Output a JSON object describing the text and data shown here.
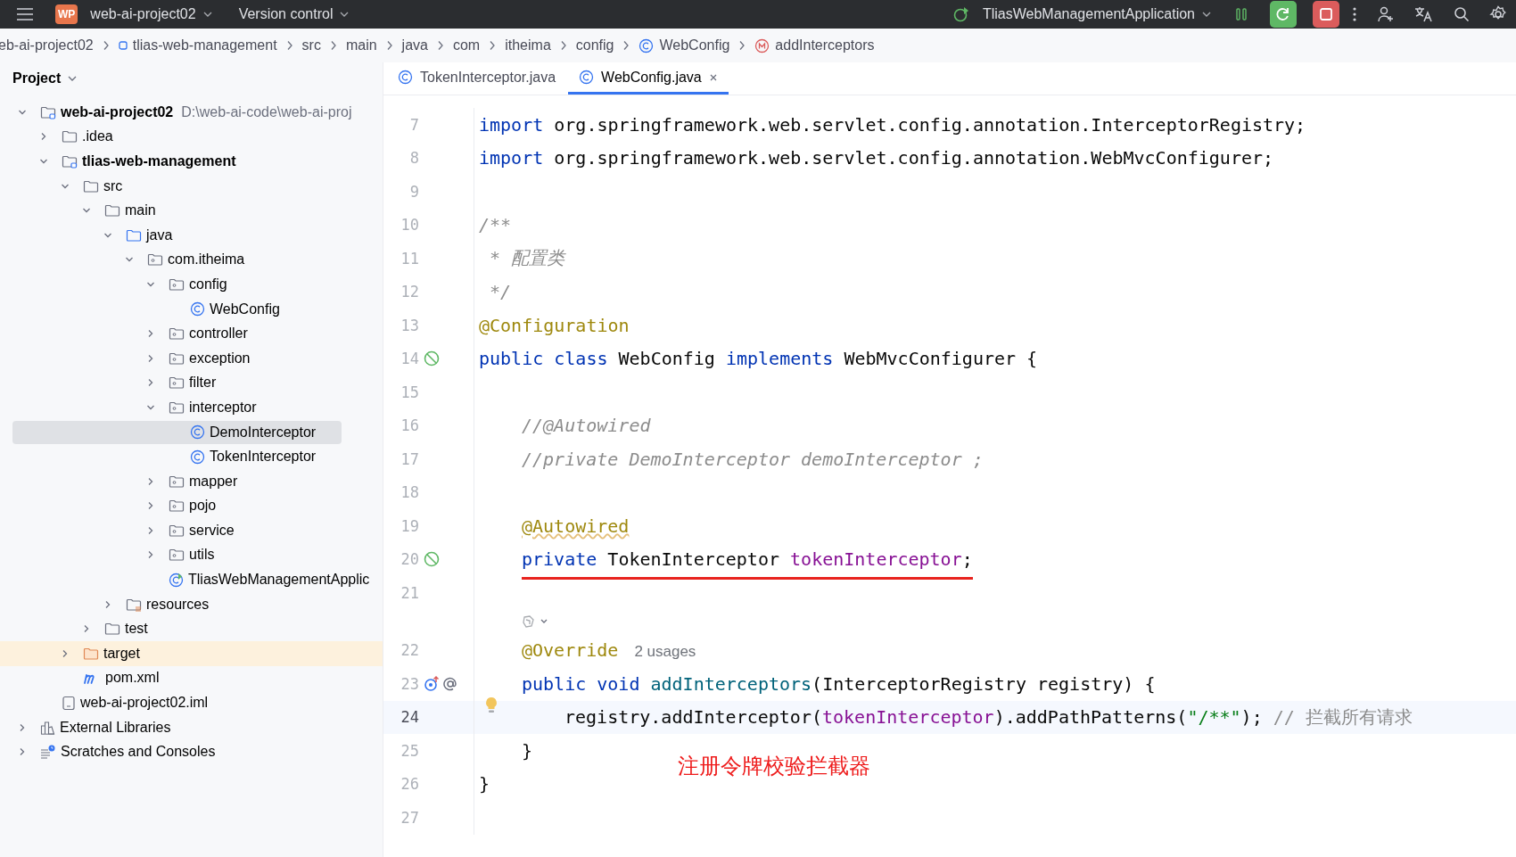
{
  "title_bar": {
    "project_badge": "WP",
    "project": "web-ai-project02",
    "vcs": "Version control",
    "run_config": "TliasWebManagementApplication"
  },
  "breadcrumbs": [
    {
      "label": "eb-ai-project02",
      "kind": "folder"
    },
    {
      "label": "tlias-web-management",
      "kind": "module"
    },
    {
      "label": "src",
      "kind": "folder"
    },
    {
      "label": "main",
      "kind": "folder"
    },
    {
      "label": "java",
      "kind": "folder"
    },
    {
      "label": "com",
      "kind": "folder"
    },
    {
      "label": "itheima",
      "kind": "folder"
    },
    {
      "label": "config",
      "kind": "folder"
    },
    {
      "label": "WebConfig",
      "kind": "class"
    },
    {
      "label": "addInterceptors",
      "kind": "method"
    }
  ],
  "project_panel": {
    "title": "Project"
  },
  "tree": [
    {
      "label": "web-ai-project02",
      "path": "D:\\web-ai-code\\web-ai-proj",
      "kind": "module",
      "expanded": true,
      "selected": false,
      "children": [
        {
          "label": ".idea",
          "kind": "folder",
          "expanded": false,
          "selected": false
        },
        {
          "label": "tlias-web-management",
          "kind": "module",
          "expanded": true,
          "selected": false,
          "children": [
            {
              "label": "src",
              "kind": "folder",
              "expanded": true,
              "selected": false,
              "children": [
                {
                  "label": "main",
                  "kind": "folder",
                  "expanded": true,
                  "selected": false,
                  "children": [
                    {
                      "label": "java",
                      "kind": "source-folder",
                      "expanded": true,
                      "selected": false,
                      "children": [
                        {
                          "label": "com.itheima",
                          "kind": "package",
                          "expanded": true,
                          "selected": false,
                          "children": [
                            {
                              "label": "config",
                              "kind": "package",
                              "expanded": true,
                              "selected": false,
                              "children": [
                                {
                                  "label": "WebConfig",
                                  "kind": "class",
                                  "selected": false
                                }
                              ]
                            },
                            {
                              "label": "controller",
                              "kind": "package",
                              "expanded": false,
                              "selected": false
                            },
                            {
                              "label": "exception",
                              "kind": "package",
                              "expanded": false,
                              "selected": false
                            },
                            {
                              "label": "filter",
                              "kind": "package",
                              "expanded": false,
                              "selected": false
                            },
                            {
                              "label": "interceptor",
                              "kind": "package",
                              "expanded": true,
                              "selected": false,
                              "children": [
                                {
                                  "label": "DemoInterceptor",
                                  "kind": "class",
                                  "selected": true
                                },
                                {
                                  "label": "TokenInterceptor",
                                  "kind": "class",
                                  "selected": false
                                }
                              ]
                            },
                            {
                              "label": "mapper",
                              "kind": "package",
                              "expanded": false,
                              "selected": false
                            },
                            {
                              "label": "pojo",
                              "kind": "package",
                              "expanded": false,
                              "selected": false
                            },
                            {
                              "label": "service",
                              "kind": "package",
                              "expanded": false,
                              "selected": false
                            },
                            {
                              "label": "utils",
                              "kind": "package",
                              "expanded": false,
                              "selected": false
                            },
                            {
                              "label": "TliasWebManagementApplic",
                              "kind": "app",
                              "selected": false
                            }
                          ]
                        }
                      ]
                    },
                    {
                      "label": "resources",
                      "kind": "resources",
                      "expanded": false,
                      "selected": false
                    }
                  ]
                },
                {
                  "label": "test",
                  "kind": "folder",
                  "expanded": false,
                  "selected": false
                }
              ]
            },
            {
              "label": "target",
              "kind": "excluded-folder",
              "expanded": false,
              "selected": false
            },
            {
              "label": "pom.xml",
              "kind": "maven",
              "selected": false
            }
          ]
        },
        {
          "label": "web-ai-project02.iml",
          "kind": "iml",
          "selected": false
        }
      ]
    },
    {
      "label": "External Libraries",
      "kind": "libraries",
      "expanded": false,
      "selected": false
    },
    {
      "label": "Scratches and Consoles",
      "kind": "scratches",
      "expanded": false,
      "selected": false
    }
  ],
  "tabs": [
    {
      "label": "TokenInterceptor.java",
      "selected": false
    },
    {
      "label": "WebConfig.java",
      "selected": true
    }
  ],
  "code_lines": [
    {
      "number": "7",
      "current": false,
      "tokens": [
        {
          "kind": "keyword",
          "text": "import"
        },
        {
          "kind": "plain",
          "text": " org.springframework.web.servlet.config.annotation.InterceptorRegistry;"
        }
      ]
    },
    {
      "number": "8",
      "current": false,
      "tokens": [
        {
          "kind": "keyword",
          "text": "import"
        },
        {
          "kind": "plain",
          "text": " org.springframework.web.servlet.config.annotation.WebMvcConfigurer;"
        }
      ]
    },
    {
      "number": "9",
      "current": false
    },
    {
      "number": "10",
      "current": false,
      "tokens": [
        {
          "kind": "doc",
          "text": "/**"
        }
      ]
    },
    {
      "number": "11",
      "current": false,
      "tokens": [
        {
          "kind": "doc",
          "text": " * 配置类"
        }
      ]
    },
    {
      "number": "12",
      "current": false,
      "tokens": [
        {
          "kind": "doc",
          "text": " */"
        }
      ]
    },
    {
      "number": "13",
      "current": false,
      "tokens": [
        {
          "kind": "annotation",
          "text": "@Configuration"
        }
      ]
    },
    {
      "number": "14",
      "current": false,
      "gutter": [
        {
          "kind": "bean"
        }
      ],
      "tokens": [
        {
          "kind": "keyword",
          "text": "public class"
        },
        {
          "kind": "plain",
          "text": " WebConfig "
        },
        {
          "kind": "keyword",
          "text": "implements"
        },
        {
          "kind": "plain",
          "text": " WebMvcConfigurer {"
        }
      ],
      "children": [
        {
          "number": "15",
          "current": false
        },
        {
          "number": "16",
          "current": false,
          "tokens": [
            {
              "kind": "comment",
              "text": "//@Autowired"
            }
          ]
        },
        {
          "number": "17",
          "current": false,
          "tokens": [
            {
              "kind": "comment",
              "text": "//private DemoInterceptor demoInterceptor ;"
            }
          ]
        },
        {
          "number": "18",
          "current": false
        },
        {
          "number": "19",
          "current": false,
          "tokens": [
            {
              "kind": "annotation-warn",
              "text": "@Autowired"
            }
          ]
        },
        {
          "number": "20",
          "current": false,
          "underlined": true,
          "gutter": [
            {
              "kind": "bean"
            }
          ],
          "tokens": [
            {
              "kind": "keyword",
              "text": "private"
            },
            {
              "kind": "plain",
              "text": " TokenInterceptor "
            },
            {
              "kind": "field",
              "text": "tokenInterceptor"
            },
            {
              "kind": "plain",
              "text": ";"
            }
          ]
        },
        {
          "number": "21",
          "current": false
        },
        {
          "kind": "inlay"
        },
        {
          "number": "22",
          "current": false,
          "tokens": [
            {
              "kind": "annotation",
              "text": "@Override"
            },
            {
              "kind": "hint",
              "text": "2 usages"
            }
          ]
        },
        {
          "number": "23",
          "current": false,
          "gutter": [
            {
              "kind": "override"
            },
            {
              "kind": "at"
            }
          ],
          "tokens": [
            {
              "kind": "keyword",
              "text": "public void"
            },
            {
              "kind": "method",
              "text": " addInterceptors"
            },
            {
              "kind": "plain",
              "text": "(InterceptorRegistry registry) {"
            }
          ],
          "children": [
            {
              "number": "24",
              "current": true,
              "bulb": true,
              "tokens": [
                {
                  "kind": "plain",
                  "text": "registry.addInterceptor("
                },
                {
                  "kind": "field",
                  "text": "tokenInterceptor"
                },
                {
                  "kind": "plain",
                  "text": ").addPathPatterns("
                },
                {
                  "kind": "string",
                  "text": "\"/**\""
                },
                {
                  "kind": "plain",
                  "text": "); "
                },
                {
                  "kind": "comment-plain",
                  "text": "// 拦截所有请求"
                }
              ]
            }
          ]
        },
        {
          "number": "25",
          "current": false,
          "tokens": [
            {
              "kind": "plain",
              "text": "}"
            }
          ]
        }
      ]
    },
    {
      "number": "26",
      "current": false,
      "tokens": [
        {
          "kind": "plain",
          "text": "}"
        }
      ]
    },
    {
      "number": "27",
      "current": false
    }
  ],
  "annotation": "注册令牌校验拦截器"
}
